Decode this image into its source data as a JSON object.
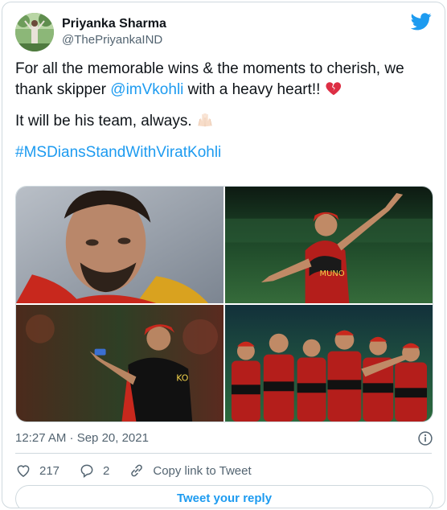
{
  "author": {
    "display_name": "Priyanka Sharma",
    "handle": "@ThePriyankaIND"
  },
  "tweet": {
    "line1_before": "For all the memorable wins & the moments to cherish, we thank skipper ",
    "mention": "@imVkohli",
    "line1_after": " with a heavy heart!! ",
    "line2": "It will be his team, always. ",
    "hashtag": "#MSDiansStandWithViratKohli"
  },
  "meta": {
    "timestamp": "12:27 AM · Sep 20, 2021"
  },
  "actions": {
    "likes": "217",
    "replies": "2",
    "copy_link": "Copy link to Tweet"
  },
  "reply_button": "Tweet your reply",
  "icons": {
    "brand": "twitter-bird-icon",
    "info": "info-icon",
    "like": "heart-icon",
    "reply": "reply-icon",
    "link": "link-icon",
    "emoji1": "broken-heart-emoji",
    "emoji2": "raised-hands-emoji"
  },
  "colors": {
    "accent": "#1d9bf0",
    "text": "#0f1419",
    "muted": "#536471",
    "border": "#cfd9de"
  }
}
